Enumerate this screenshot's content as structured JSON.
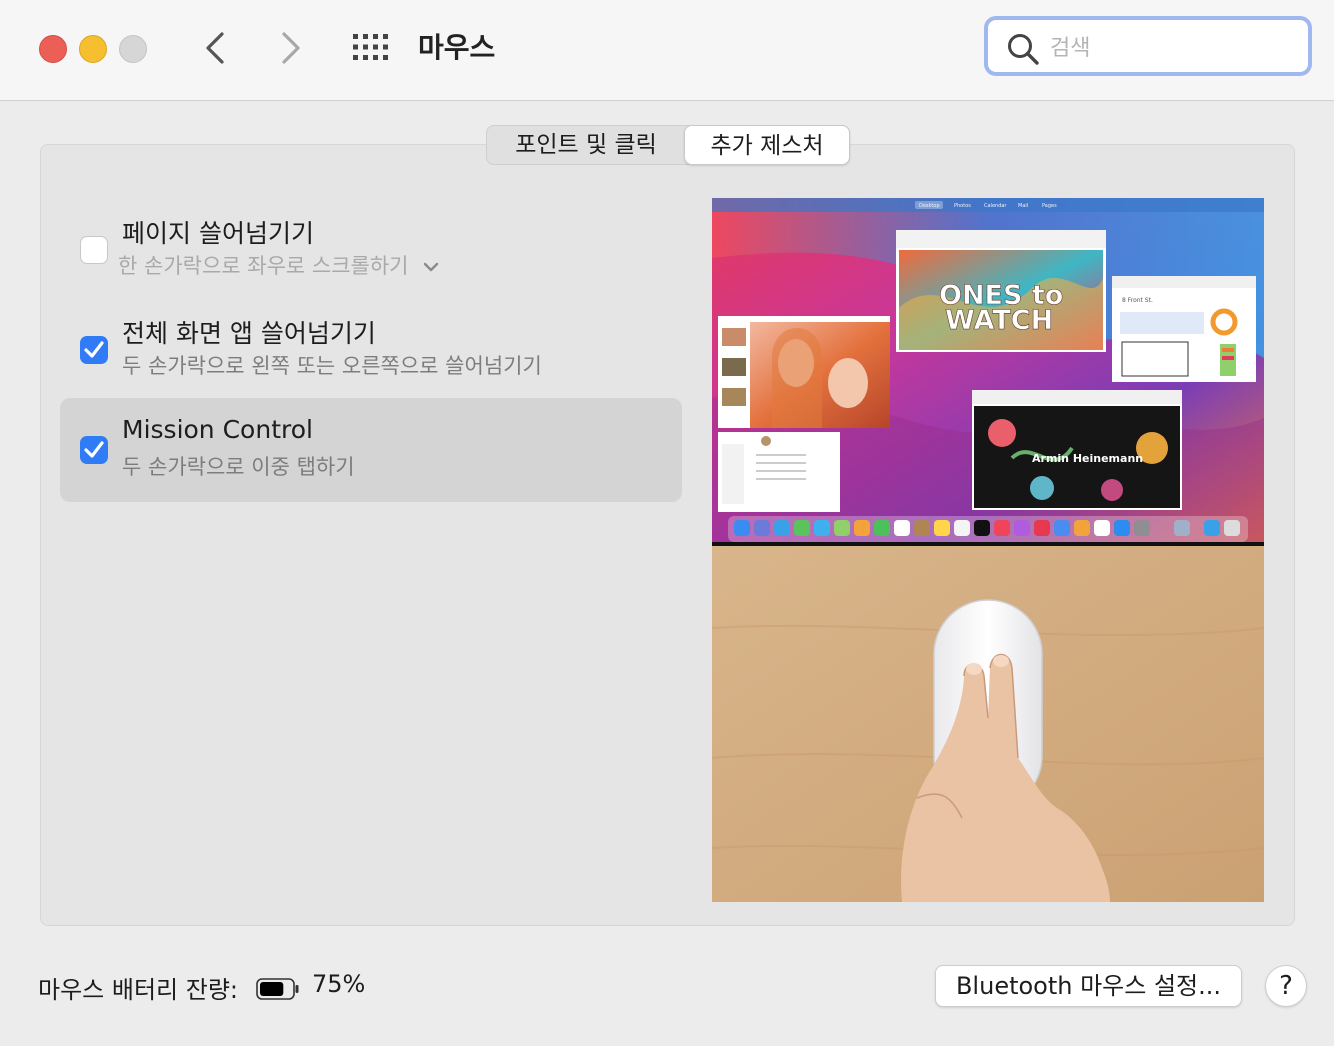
{
  "window": {
    "title": "마우스"
  },
  "search": {
    "placeholder": "검색",
    "value": ""
  },
  "tabs": [
    {
      "label": "포인트 및 클릭",
      "selected": false
    },
    {
      "label": "추가 제스처",
      "selected": true
    }
  ],
  "options": [
    {
      "title": "페이지 쓸어넘기기",
      "subtitle": "한 손가락으로 좌우로 스크롤하기",
      "checked": false,
      "has_dropdown": true
    },
    {
      "title": "전체 화면 앱 쓸어넘기기",
      "subtitle": "두 손가락으로 왼쪽 또는 오른쪽으로 쓸어넘기기",
      "checked": true
    },
    {
      "title": "Mission Control",
      "subtitle": "두 손가락으로 이중 탭하기",
      "checked": true,
      "selected": true
    }
  ],
  "preview": {
    "menu_items": [
      "Desktop",
      "Photos",
      "Calendar",
      "Mail",
      "Pages"
    ],
    "poster_line1": "ONES to",
    "poster_line2": "WATCH",
    "artist_name": "Armin Heinemann",
    "sheet_title": "8 Front St."
  },
  "footer": {
    "battery_label": "마우스 배터리 잔량:",
    "battery_percent": "75%",
    "battery_level": 0.75,
    "bluetooth_button": "Bluetooth 마우스 설정...",
    "help_button": "?"
  },
  "colors": {
    "accent": "#2f7cf6",
    "close": "#ec5f57",
    "minimize": "#f5bf2f",
    "zoom_inactive": "#d6d6d6"
  },
  "icons": [
    "back-chevron-icon",
    "forward-chevron-icon",
    "grid-icon",
    "search-icon",
    "checkmark-icon",
    "chevron-down-icon",
    "battery-icon"
  ]
}
